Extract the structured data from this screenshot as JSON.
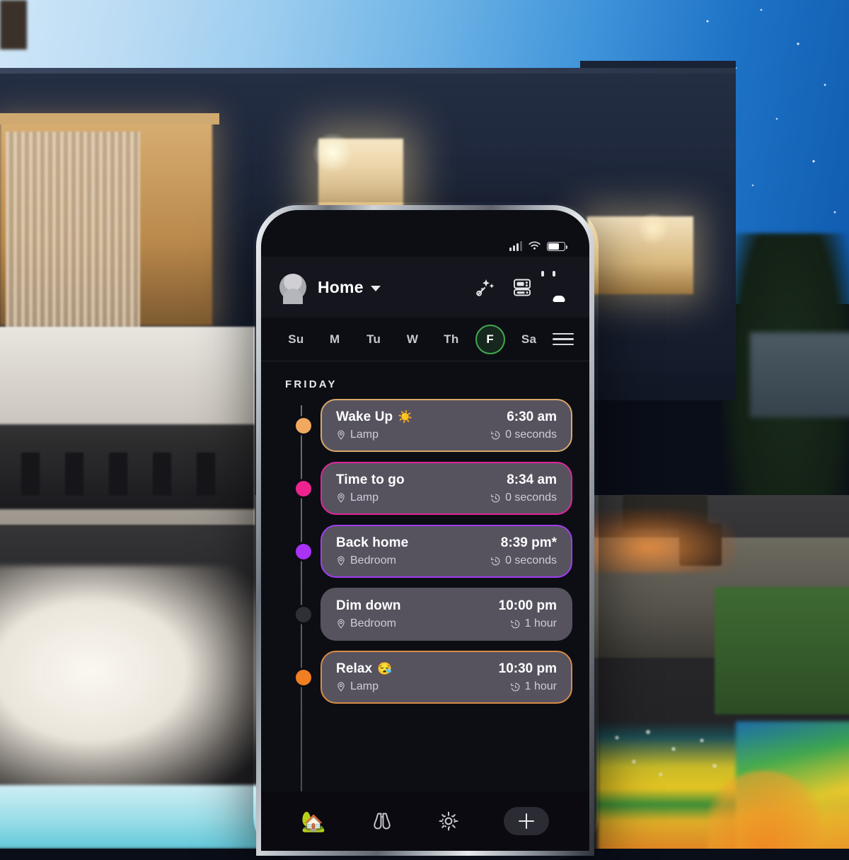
{
  "background": {
    "description": "modern-house-at-dusk-with-lit-pool"
  },
  "statusbar": {
    "signal_icon": "cellular-signal-icon",
    "wifi_icon": "wifi-icon",
    "battery_icon": "battery-icon"
  },
  "header": {
    "avatar_icon": "avatar-icon",
    "title": "Home",
    "chevron_icon": "chevron-down-icon",
    "icons": [
      {
        "name": "magic-wand-icon",
        "label": ""
      },
      {
        "name": "devices-panel-icon",
        "label": ""
      },
      {
        "name": "calendar-icon",
        "label": ""
      }
    ]
  },
  "daystrip": {
    "days": [
      {
        "label": "Su",
        "selected": false
      },
      {
        "label": "M",
        "selected": false
      },
      {
        "label": "Tu",
        "selected": false
      },
      {
        "label": "W",
        "selected": false
      },
      {
        "label": "Th",
        "selected": false
      },
      {
        "label": "F",
        "selected": true
      },
      {
        "label": "Sa",
        "selected": false
      }
    ],
    "menu_icon": "hamburger-menu-icon",
    "selected_color": "#3faa4f"
  },
  "schedule": {
    "day_title": "FRIDAY",
    "events": [
      {
        "title": "Wake Up",
        "emoji": "☀️",
        "time": "6:30 am",
        "room": "Lamp",
        "duration": "0 seconds",
        "dot_color": "#f0a95e",
        "border_color": "#d9a86a"
      },
      {
        "title": "Time to go",
        "emoji": "",
        "time": "8:34 am",
        "room": "Lamp",
        "duration": "0 seconds",
        "dot_color": "#ef2390",
        "border_color": "#e0259a"
      },
      {
        "title": "Back home",
        "emoji": "",
        "time": "8:39 pm*",
        "room": "Bedroom",
        "duration": "0 seconds",
        "dot_color": "#ab32f5",
        "border_color": "#a13df0"
      },
      {
        "title": "Dim down",
        "emoji": "",
        "time": "10:00 pm",
        "room": "Bedroom",
        "duration": "1 hour",
        "dot_color": "#2f2f38",
        "border_color": "transparent"
      },
      {
        "title": "Relax",
        "emoji": "😪",
        "time": "10:30 pm",
        "room": "Lamp",
        "duration": "1 hour",
        "dot_color": "#ef7f22",
        "border_color": "#d98b44"
      }
    ],
    "room_icon": "location-pin-icon",
    "duration_icon": "clock-history-icon"
  },
  "navbar": {
    "items": [
      {
        "name": "nav-home",
        "icon": "house-emoji-icon",
        "glyph": "🏡",
        "active": true
      },
      {
        "name": "nav-explore",
        "icon": "binoculars-icon",
        "glyph": "",
        "active": false
      },
      {
        "name": "nav-settings",
        "icon": "gear-icon",
        "glyph": "",
        "active": false
      }
    ],
    "add_button_icon": "plus-icon"
  }
}
